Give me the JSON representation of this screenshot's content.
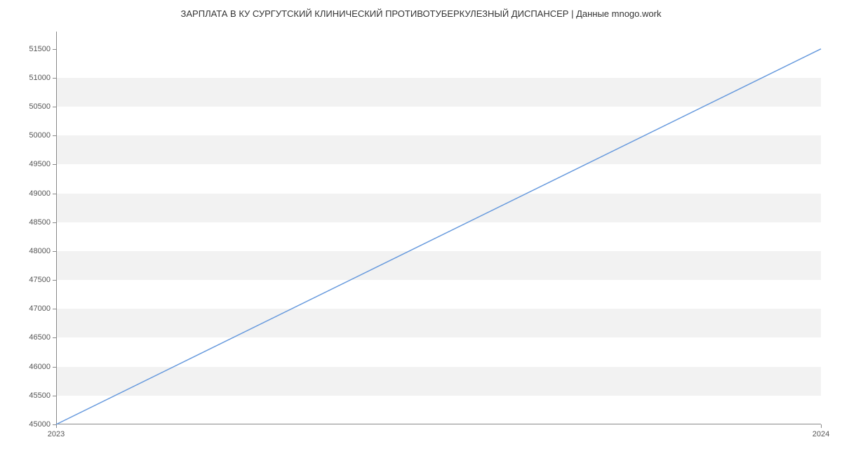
{
  "chart_data": {
    "type": "line",
    "title": "ЗАРПЛАТА В КУ СУРГУТСКИЙ КЛИНИЧЕСКИЙ ПРОТИВОТУБЕРКУЛЕЗНЫЙ ДИСПАНСЕР | Данные mnogo.work",
    "x": [
      2023,
      2024
    ],
    "values": [
      45000,
      51500
    ],
    "x_ticks": [
      2023,
      2024
    ],
    "y_ticks": [
      45000,
      45500,
      46000,
      46500,
      47000,
      47500,
      48000,
      48500,
      49000,
      49500,
      50000,
      50500,
      51000,
      51500
    ],
    "xlim": [
      2023,
      2024
    ],
    "ylim": [
      45000,
      51800
    ],
    "xlabel": "",
    "ylabel": "",
    "line_color": "#6699dd",
    "grid_band_color": "#f2f2f2"
  }
}
